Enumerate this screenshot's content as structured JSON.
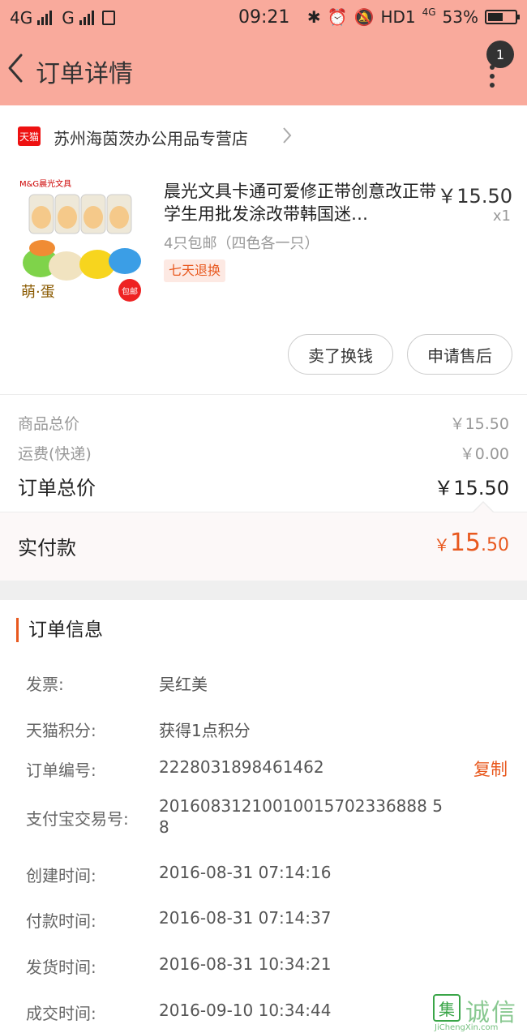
{
  "status_bar": {
    "network1": "4G",
    "network2": "G",
    "time": "09:21",
    "hd": "HD1",
    "network3": "4G",
    "battery_percent": "53%"
  },
  "header": {
    "title": "订单详情",
    "badge_count": "1"
  },
  "store": {
    "badge": "天猫",
    "name": "苏州海茵茨办公用品专营店"
  },
  "product": {
    "title": "晨光文具卡通可爱修正带创意改正带学生用批发涂改带韩国迷…",
    "price": "￥15.50",
    "quantity": "x1",
    "spec": "4只包邮（四色各一只）",
    "tag": "七天退换",
    "image_brand": "M&G晨光文具",
    "image_caption": "萌·蛋",
    "image_sticker": "包邮"
  },
  "actions": {
    "sell_label": "卖了换钱",
    "after_sale_label": "申请售后"
  },
  "summary": {
    "goods_total_label": "商品总价",
    "goods_total": "￥15.50",
    "shipping_label": "运费(快递)",
    "shipping": "￥0.00",
    "order_total_label": "订单总价",
    "order_total": "￥15.50",
    "paid_label": "实付款",
    "paid_currency": "￥",
    "paid_int": "15",
    "paid_dec": ".50"
  },
  "order_info": {
    "title": "订单信息",
    "invoice_label": "发票:",
    "invoice": "吴红美",
    "points_label": "天猫积分:",
    "points": "获得1点积分",
    "order_no_label": "订单编号:",
    "order_no": "2228031898461462",
    "copy_label": "复制",
    "alipay_label": "支付宝交易号:",
    "alipay_line1": "20160831210010015702336888 5",
    "alipay_line2": "8",
    "created_label": "创建时间:",
    "created": "2016-08-31 07:14:16",
    "paid_label": "付款时间:",
    "paid": "2016-08-31 07:14:37",
    "shipped_label": "发货时间:",
    "shipped": "2016-08-31 10:34:21",
    "completed_label": "成交时间:",
    "completed": "2016-09-10 10:34:44"
  },
  "watermark": {
    "mark": "集",
    "text": "诚信",
    "url": "JiChengXin.com"
  },
  "colors": {
    "header_bg": "#f9aa9c",
    "accent": "#e8581e",
    "tmall_red": "#ee1111"
  }
}
